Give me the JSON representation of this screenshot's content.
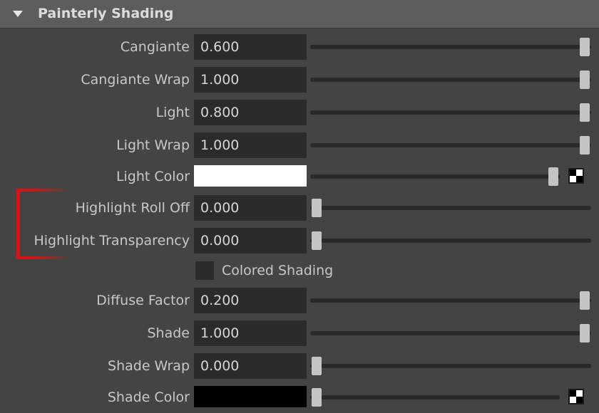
{
  "section": {
    "title": "Painterly Shading"
  },
  "rows": {
    "cangiante": {
      "label": "Cangiante",
      "value": "0.600",
      "slider": 1.0
    },
    "cangiante_wrap": {
      "label": "Cangiante Wrap",
      "value": "1.000",
      "slider": 1.0
    },
    "light": {
      "label": "Light",
      "value": "0.800",
      "slider": 1.0
    },
    "light_wrap": {
      "label": "Light Wrap",
      "value": "1.000",
      "slider": 1.0
    },
    "light_color": {
      "label": "Light Color",
      "color": "#ffffff",
      "slider": 1.0,
      "map_icon": "checker-map-icon"
    },
    "highlight_roll_off": {
      "label": "Highlight Roll Off",
      "value": "0.000",
      "slider": 0.0
    },
    "highlight_transparency": {
      "label": "Highlight Transparency",
      "value": "0.000",
      "slider": 0.0
    },
    "colored_shading": {
      "label": "Colored Shading",
      "checked": false
    },
    "diffuse_factor": {
      "label": "Diffuse Factor",
      "value": "0.200",
      "slider": 1.0
    },
    "shade": {
      "label": "Shade",
      "value": "1.000",
      "slider": 1.0
    },
    "shade_wrap": {
      "label": "Shade Wrap",
      "value": "0.000",
      "slider": 0.0
    },
    "shade_color": {
      "label": "Shade Color",
      "color": "#000000",
      "slider": 0.0,
      "map_icon": "checker-map-icon"
    }
  },
  "annotation": {
    "color": "#dd1111"
  }
}
